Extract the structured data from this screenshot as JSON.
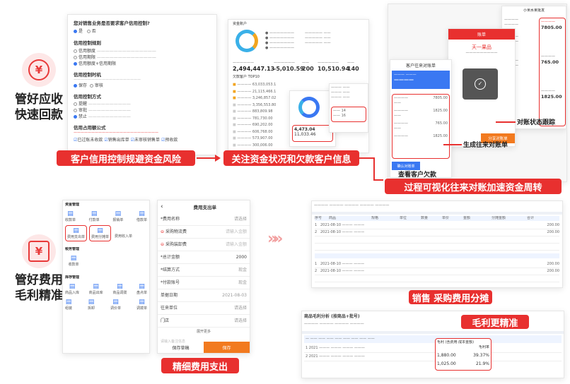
{
  "section1": {
    "title_line1": "管好应收",
    "title_line2": "快速回款",
    "icon": "yen-coin-icon"
  },
  "section2": {
    "title_line1": "管好费用",
    "title_line2": "毛利精准",
    "icon": "yen-box-icon"
  },
  "captions": {
    "credit": "客户信用控制规避资金风险",
    "funds": "关注资金状况和欠款客户信息",
    "reconcile": "过程可视化往来对账加速资金周转",
    "expense": "精细费用支出",
    "allocate": "销售 采购费用分摊",
    "margin": "毛利更精准"
  },
  "credit_form": {
    "q1": "您对销售业务是否要求客户信用控制?",
    "q1_opts": [
      "是",
      "否"
    ],
    "q2": "信用控制规则",
    "q2_opts": [
      "信用额度",
      "信用期限",
      "信用额度+信用期限"
    ],
    "q3": "信用控制时机",
    "q3_opts": [
      "保存",
      "审核"
    ],
    "q4": "信用控制方式",
    "q4_opts": [
      "提醒",
      "审批",
      "禁止"
    ],
    "q5": "信用占用额公式",
    "q5_checks": [
      "已过账未收款",
      "销售出库单",
      "未审核销售单",
      "预收款"
    ]
  },
  "dashboard": {
    "total": "2,494,447.13",
    "v2": "-5,010.59",
    "v3": "200",
    "v4": "10,510.94",
    "v5": "140",
    "list_title": "欠款客户 TOP10",
    "amounts": [
      "63,033,053.1",
      "21,115,466.1",
      "3,246,857.02",
      "3,356,553.80",
      "883,809.98",
      "781,730.00",
      "690,202.00",
      "606,768.00",
      "573,907.00",
      "300,006.00"
    ],
    "overlay_a": "4,473.04",
    "overlay_b": "11,033.46",
    "overlay_c": "14",
    "overlay_d": "16"
  },
  "reconcile": {
    "label_debt": "查看客户欠款",
    "label_statement": "生成往来对账单",
    "label_status": "对账状态跟踪",
    "phone_title": "客户往来对账单",
    "phone2_title": "账单",
    "phone2_item": "天一果品",
    "phone3_title": "小米水果批发",
    "amounts": [
      "7805.00",
      "765.00",
      "1825.00"
    ],
    "btn_confirm": "确认对账单",
    "btn_share": "分享对账单"
  },
  "menu": {
    "sec1": "资金管理",
    "row1": [
      "收款单",
      "付款单",
      "报销单",
      "借款单"
    ],
    "row2": [
      "费用支出单",
      "费用分摊单",
      "费用收入单"
    ],
    "sec2": "税务管理",
    "row3": [
      "收款单"
    ],
    "sec3": "库存管理",
    "row4": [
      "商品入库",
      "商品出库",
      "商品调拨",
      "盘点单"
    ],
    "row5": [
      "组装",
      "拆卸",
      "调价单",
      "调拨单"
    ]
  },
  "expense_form": {
    "title": "费用支出单",
    "f_category": "*费用名称",
    "f_category_val": "请选择",
    "item1": "采购物流费",
    "item1_ph": "请输入金额",
    "item2": "采购装卸费",
    "item2_ph": "请输入金额",
    "f_total": "*总计金额",
    "f_total_val": "2000",
    "f_pay": "*结算方式",
    "f_pay_val": "现金",
    "f_account": "*付款账号",
    "f_account_val": "现金",
    "f_date": "单据日期",
    "f_date_val": "2021-08-03",
    "f_dept": "往来单位",
    "f_dept_val": "请选择",
    "f_store": "门店",
    "f_store_val": "请选择",
    "more": "展开更多",
    "memo_ph": "请输入备注信息",
    "btn_draft": "保存草稿",
    "btn_save": "保存"
  },
  "allocate_table": {
    "header": [
      "序号",
      "商品",
      "规格",
      "单位",
      "数量",
      "单价",
      "金额",
      "分摊金额",
      "合计"
    ],
    "rows": [
      [
        "1",
        "2021-08-10",
        "1",
        "200.00"
      ],
      [
        "2",
        "2021-08-10",
        "1",
        "200.00"
      ]
    ]
  },
  "margin_table": {
    "title": "商品毛利分析 (按商品+批号)",
    "col_cost": "毛利 (含费用·成本金额)",
    "col_rate": "毛利率",
    "vals": [
      [
        "1,880.00",
        "39.37%"
      ],
      [
        "1,025.00",
        "21.9%"
      ]
    ]
  }
}
